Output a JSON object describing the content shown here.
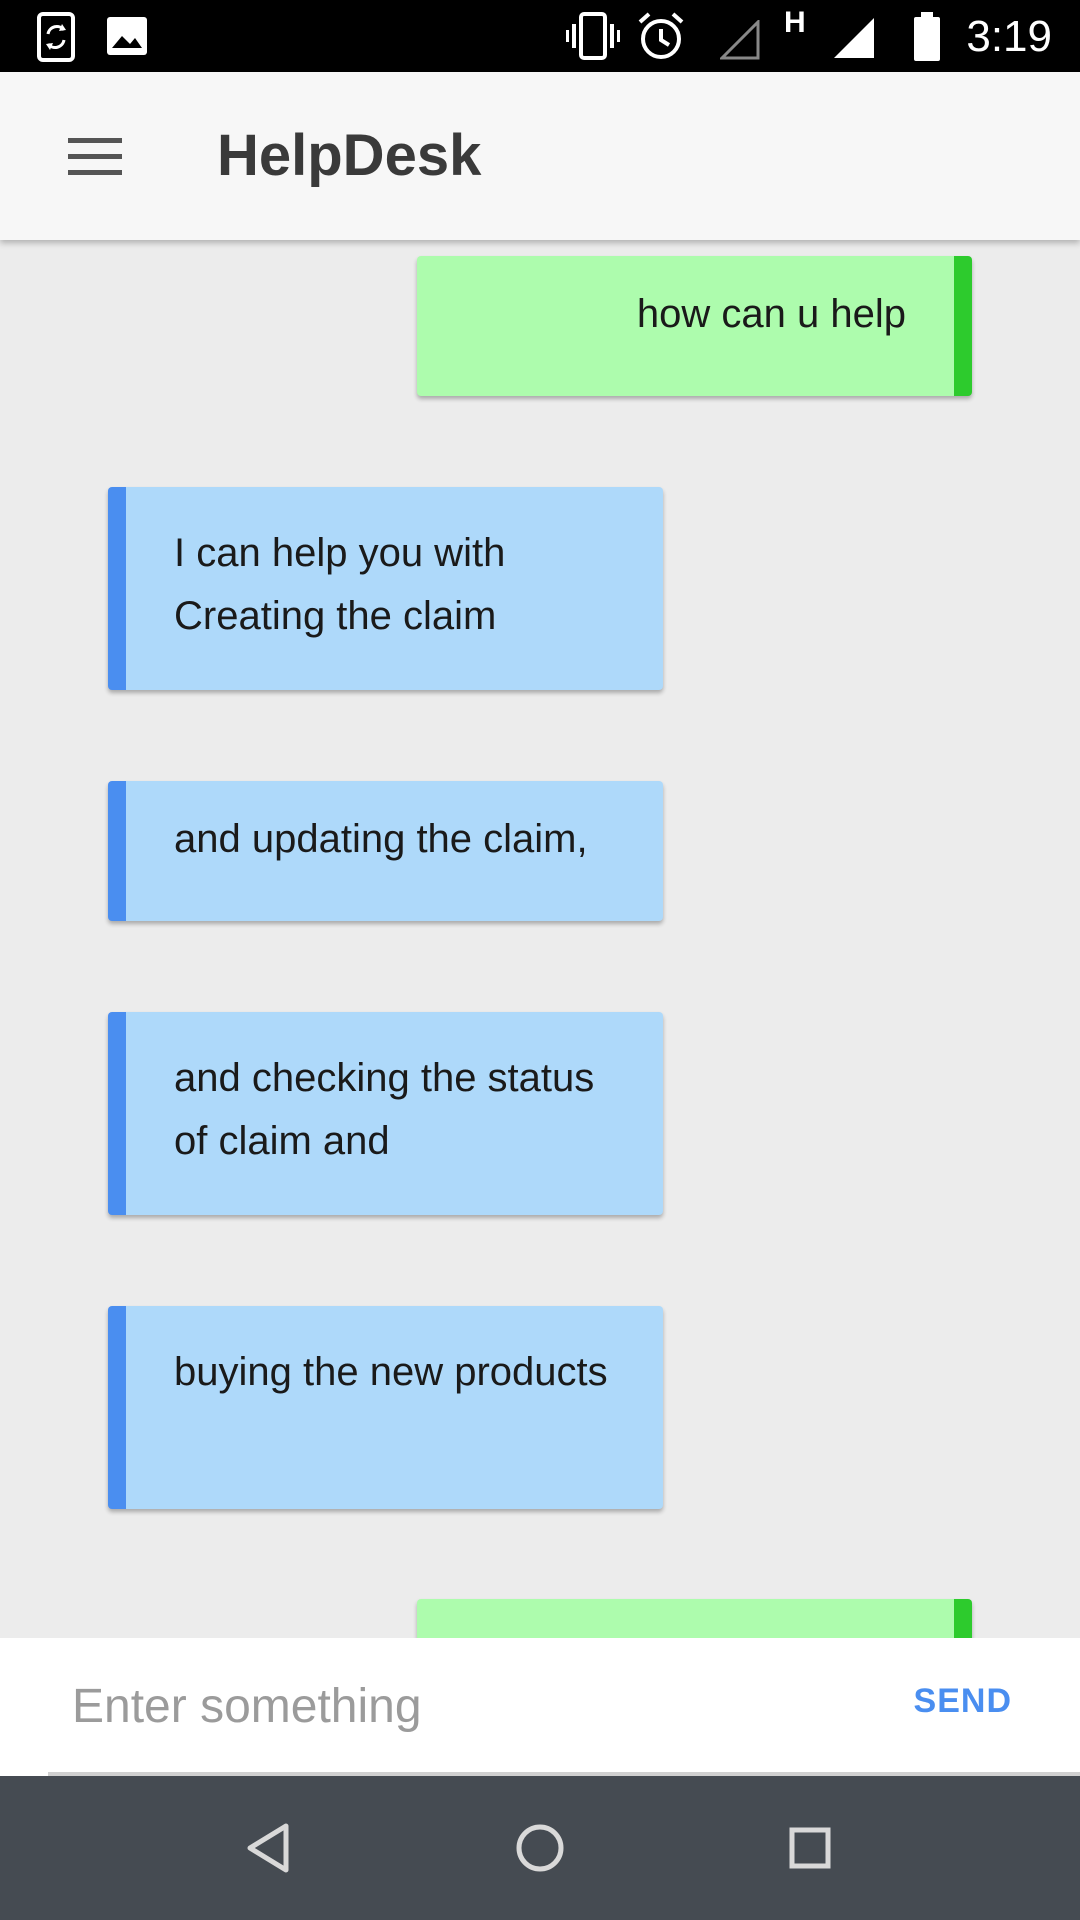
{
  "status_bar": {
    "time": "3:19",
    "network_label": "H",
    "icons": [
      "sync-phone-icon",
      "image-icon",
      "vibrate-icon",
      "alarm-icon",
      "no-signal-icon",
      "signal-icon",
      "battery-icon"
    ]
  },
  "app_bar": {
    "title": "HelpDesk",
    "menu_icon": "hamburger-menu-icon"
  },
  "messages": [
    {
      "sender": "user",
      "text": "how can u help"
    },
    {
      "sender": "bot",
      "text": "I can help you with Creating the claim"
    },
    {
      "sender": "bot",
      "text": "and updating the claim,"
    },
    {
      "sender": "bot",
      "text": "and checking the status of claim and"
    },
    {
      "sender": "bot",
      "text": "buying the new products"
    },
    {
      "sender": "user",
      "text": ""
    }
  ],
  "input": {
    "placeholder": "Enter something",
    "value": "",
    "send_label": "SEND"
  },
  "nav_bar": {
    "icons": [
      "back-icon",
      "home-icon",
      "recents-icon"
    ]
  },
  "colors": {
    "user_bubble": "#adfcad",
    "user_accent": "#2dcb2d",
    "bot_bubble": "#aed9fa",
    "bot_accent": "#4a8ef0",
    "background": "#ececec",
    "send": "#4a8ef0"
  }
}
